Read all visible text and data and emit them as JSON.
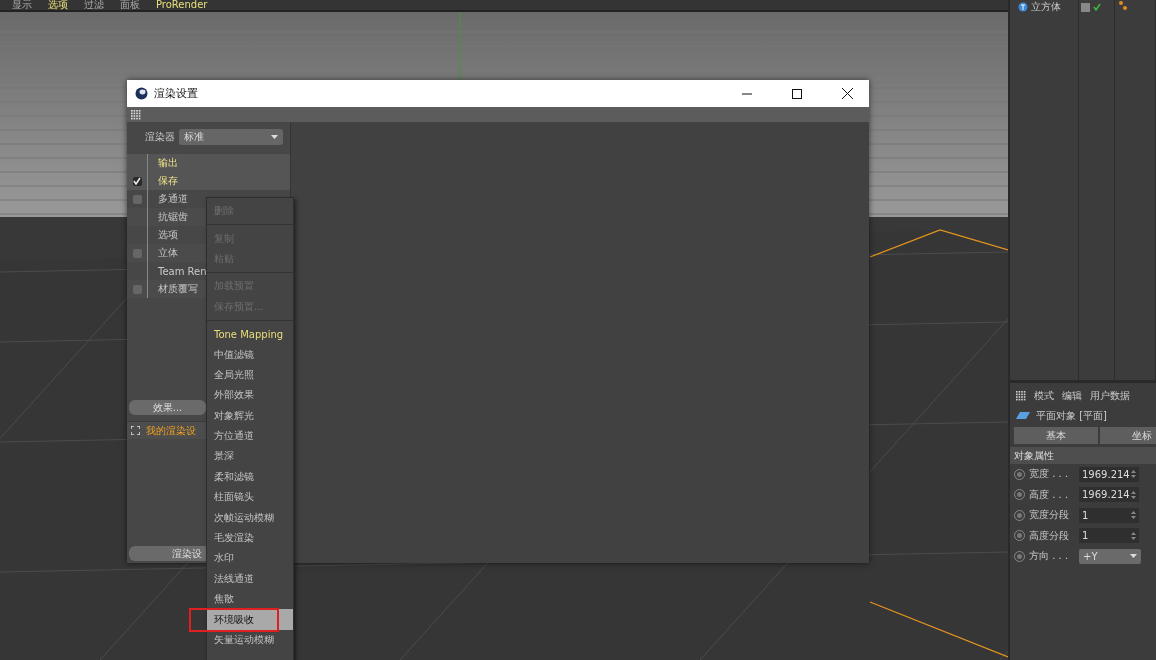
{
  "menu_bar": [
    {
      "label": "显示",
      "active": false
    },
    {
      "label": "选项",
      "active": true
    },
    {
      "label": "过滤",
      "active": false
    },
    {
      "label": "面板",
      "active": false
    },
    {
      "label": "ProRender",
      "active": true
    }
  ],
  "object_manager": {
    "objects": [
      {
        "name": "立方体",
        "visible": true
      }
    ]
  },
  "dialog": {
    "title": "渲染设置",
    "renderer": {
      "label": "渲染器",
      "value": "标准"
    },
    "tree": [
      {
        "label": "输出",
        "kind": "plain",
        "selected": true
      },
      {
        "label": "保存",
        "kind": "check",
        "checked": true,
        "selected": true
      },
      {
        "label": "多通道",
        "kind": "check",
        "checked": false,
        "selected": false
      },
      {
        "label": "抗锯齿",
        "kind": "plain",
        "selected": false
      },
      {
        "label": "选项",
        "kind": "plain",
        "selected": false
      },
      {
        "label": "立体",
        "kind": "check",
        "checked": false,
        "selected": false
      },
      {
        "label": "Team Ren",
        "kind": "plain",
        "selected": false
      },
      {
        "label": "材质覆写",
        "kind": "check",
        "checked": false,
        "selected": false
      }
    ],
    "effects_button": "效果...",
    "settings_list": [
      "我的渲染设"
    ],
    "render_button": "渲染设"
  },
  "context_menu": [
    {
      "kind": "item",
      "label": "删除",
      "disabled": true,
      "accent": false,
      "selected": false,
      "marked": false
    },
    {
      "kind": "separator"
    },
    {
      "kind": "item",
      "label": "复制",
      "disabled": true,
      "accent": false,
      "selected": false,
      "marked": false
    },
    {
      "kind": "item",
      "label": "粘贴",
      "disabled": true,
      "accent": false,
      "selected": false,
      "marked": false
    },
    {
      "kind": "separator"
    },
    {
      "kind": "item",
      "label": "加载预置",
      "disabled": true,
      "accent": false,
      "selected": false,
      "marked": false
    },
    {
      "kind": "item",
      "label": "保存预置...",
      "disabled": true,
      "accent": false,
      "selected": false,
      "marked": false
    },
    {
      "kind": "separator"
    },
    {
      "kind": "item",
      "label": "Tone Mapping",
      "disabled": false,
      "accent": true,
      "selected": false,
      "marked": false
    },
    {
      "kind": "item",
      "label": "中值滤镜",
      "disabled": false,
      "accent": false,
      "selected": false,
      "marked": false
    },
    {
      "kind": "item",
      "label": "全局光照",
      "disabled": false,
      "accent": false,
      "selected": false,
      "marked": false
    },
    {
      "kind": "item",
      "label": "外部效果",
      "disabled": false,
      "accent": false,
      "selected": false,
      "marked": false
    },
    {
      "kind": "item",
      "label": "对象辉光",
      "disabled": false,
      "accent": false,
      "selected": false,
      "marked": false
    },
    {
      "kind": "item",
      "label": "方位通道",
      "disabled": false,
      "accent": false,
      "selected": false,
      "marked": false
    },
    {
      "kind": "item",
      "label": "景深",
      "disabled": false,
      "accent": false,
      "selected": false,
      "marked": false
    },
    {
      "kind": "item",
      "label": "柔和滤镜",
      "disabled": false,
      "accent": false,
      "selected": false,
      "marked": false
    },
    {
      "kind": "item",
      "label": "柱面镜头",
      "disabled": false,
      "accent": false,
      "selected": false,
      "marked": false
    },
    {
      "kind": "item",
      "label": "次帧运动模糊",
      "disabled": false,
      "accent": false,
      "selected": false,
      "marked": false
    },
    {
      "kind": "item",
      "label": "毛发渲染",
      "disabled": false,
      "accent": false,
      "selected": false,
      "marked": false
    },
    {
      "kind": "item",
      "label": "水印",
      "disabled": false,
      "accent": false,
      "selected": false,
      "marked": false
    },
    {
      "kind": "item",
      "label": "法线通道",
      "disabled": false,
      "accent": false,
      "selected": false,
      "marked": false
    },
    {
      "kind": "item",
      "label": "焦散",
      "disabled": false,
      "accent": false,
      "selected": false,
      "marked": false
    },
    {
      "kind": "item",
      "label": "环境吸收",
      "disabled": false,
      "accent": false,
      "selected": true,
      "marked": true
    },
    {
      "kind": "item",
      "label": "矢量运动模糊",
      "disabled": false,
      "accent": false,
      "selected": false,
      "marked": false
    }
  ],
  "attributes": {
    "toolbar": [
      "模式",
      "编辑",
      "用户数据"
    ],
    "object_title": "平面对象 [平面]",
    "tabs": [
      "基本",
      "坐标"
    ],
    "section": "对象属性",
    "fields": [
      {
        "label": "宽度 . . .",
        "value": "1969.214",
        "kind": "number"
      },
      {
        "label": "高度 . . .",
        "value": "1969.214",
        "kind": "number"
      },
      {
        "label": "宽度分段",
        "value": "1",
        "kind": "number"
      },
      {
        "label": "高度分段",
        "value": "1",
        "kind": "number"
      },
      {
        "label": "方向 . . .",
        "value": "+Y",
        "kind": "dropdown"
      }
    ]
  }
}
